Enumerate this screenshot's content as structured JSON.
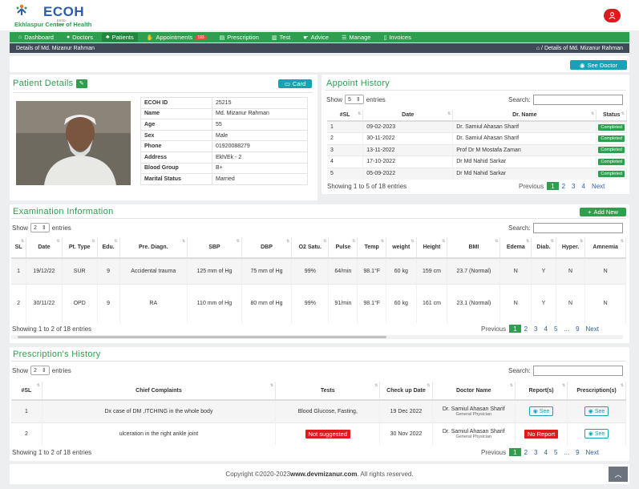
{
  "brand": {
    "name": "ECOH",
    "est": "ESTD. 1999",
    "subtitle": "Ekhlaspur Center of Health"
  },
  "nav": [
    {
      "label": "Dashboard",
      "icon": "dashboard-icon",
      "glyph": "⌂",
      "badge": ""
    },
    {
      "label": "Doctors",
      "icon": "user-md-icon",
      "glyph": "●",
      "badge": ""
    },
    {
      "label": "Patients",
      "icon": "users-icon",
      "glyph": "♣",
      "badge": ""
    },
    {
      "label": "Appointments",
      "icon": "handshake-icon",
      "glyph": "✋",
      "badge": "193"
    },
    {
      "label": "Prescription",
      "icon": "prescription-icon",
      "glyph": "▤",
      "badge": ""
    },
    {
      "label": "Test",
      "icon": "test-icon",
      "glyph": "▥",
      "badge": ""
    },
    {
      "label": "Advice",
      "icon": "advice-icon",
      "glyph": "☛",
      "badge": ""
    },
    {
      "label": "Manage",
      "icon": "list-icon",
      "glyph": "☰",
      "badge": ""
    },
    {
      "label": "Invoices",
      "icon": "invoice-icon",
      "glyph": "▯",
      "badge": ""
    }
  ],
  "breadcrumb": {
    "page": "Details of Md. Mizanur Rahman",
    "trail": "Details of Md. Mizanur Rahman",
    "sep": "/"
  },
  "see_doctor": "See Doctor",
  "patient": {
    "title": "Patient Details",
    "card_btn": "Card",
    "fields": [
      {
        "k": "ECOH ID",
        "v": "25215"
      },
      {
        "k": "Name",
        "v": "Md. Mizanur Rahman"
      },
      {
        "k": "Age",
        "v": "55"
      },
      {
        "k": "Sex",
        "v": "Male"
      },
      {
        "k": "Phone",
        "v": "01920088279"
      },
      {
        "k": "Address",
        "v": "Ekh/Ek - 2"
      },
      {
        "k": "Blood Group",
        "v": "B+"
      },
      {
        "k": "Marital Status",
        "v": "Married"
      }
    ]
  },
  "appoint": {
    "title": "Appoint History",
    "show": "Show",
    "entries": "entries",
    "show_val": "5",
    "search": "Search:",
    "headers": [
      "#SL",
      "Date",
      "Dr. Name",
      "Status"
    ],
    "rows": [
      [
        "1",
        "09-02-2023",
        "Dr. Samiul Ahasan Sharif",
        "Completed"
      ],
      [
        "2",
        "30-11-2022",
        "Dr. Samiul Ahasan Sharif",
        "Completed"
      ],
      [
        "3",
        "13-11-2022",
        "Prof Dr M Mostafa Zaman",
        "Completed"
      ],
      [
        "4",
        "17-10-2022",
        "Dr Md Nahid Sarkar",
        "Completed"
      ],
      [
        "5",
        "05-09-2022",
        "Dr Md Nahid Sarkar",
        "Completed"
      ]
    ],
    "info": "Showing 1 to 5 of 18 entries",
    "pager": {
      "prev": "Previous",
      "pages": [
        "1",
        "2",
        "3",
        "4"
      ],
      "next": "Next"
    }
  },
  "exam": {
    "title": "Examination Information",
    "add_btn": "Add New",
    "show": "Show",
    "entries": "entries",
    "show_val": "2",
    "search": "Search:",
    "headers": [
      "SL",
      "Date",
      "Pt. Type",
      "Edu.",
      "Pre. Diagn.",
      "SBP",
      "DBP",
      "O2 Satu.",
      "Pulse",
      "Temp",
      "weight",
      "Height",
      "BMI",
      "Edema",
      "Diab.",
      "Hyper.",
      "Amnemia"
    ],
    "rows": [
      [
        "1",
        "19/12/22",
        "SUR",
        "9",
        "Accidental trauma",
        "125 mm of Hg",
        "75 mm of Hg",
        "99%",
        "64/min",
        "98.1°F",
        "60 kg",
        "159 cm",
        "23.7 (Normal)",
        "N",
        "Y",
        "N",
        "N"
      ],
      [
        "2",
        "30/11/22",
        "OPD",
        "9",
        "RA",
        "110 mm of Hg",
        "80 mm of Hg",
        "99%",
        "91/min",
        "98.1°F",
        "60 kg",
        "161 cm",
        "23.1 (Normal)",
        "N",
        "Y",
        "N",
        "N"
      ]
    ],
    "info": "Showing 1 to 2 of 18 entries",
    "pager": {
      "prev": "Previous",
      "pages": [
        "1",
        "2",
        "3",
        "4",
        "5",
        "...",
        "9"
      ],
      "next": "Next"
    }
  },
  "presc": {
    "title": "Prescription's History",
    "show": "Show",
    "entries": "entries",
    "show_val": "2",
    "search": "Search:",
    "headers": [
      "#SL",
      "Chief Complaints",
      "Tests",
      "Check up Date",
      "Doctor Name",
      "Report(s)",
      "Prescription(s)"
    ],
    "rows": [
      {
        "sl": "1",
        "cc": "Dx case of DM ,ITCHING in the whole body",
        "tests": "Blood Glucose, Fasting,",
        "tests_flag": false,
        "date": "19 Dec 2022",
        "doc": "Dr. Samiul Ahasan Sharif",
        "role": "General Physician",
        "report": "See",
        "report_flag": false,
        "presc": "See"
      },
      {
        "sl": "2",
        "cc": "ulceration in the right ankle joint",
        "tests": "Not suggested",
        "tests_flag": true,
        "date": "30 Nov 2022",
        "doc": "Dr. Samiul Ahasan Sharif",
        "role": "General Physician",
        "report": "No Report",
        "report_flag": true,
        "presc": "See"
      }
    ],
    "info": "Showing 1 to 2 of 18 entries",
    "pager": {
      "prev": "Previous",
      "pages": [
        "1",
        "2",
        "3",
        "4",
        "5",
        "...",
        "9"
      ],
      "next": "Next"
    }
  },
  "footer": {
    "pre": "Copyright ©2020-2023 ",
    "link": "www.devmizanur.com",
    "post": ". All rights reserved."
  },
  "colors": {
    "green": "#2e9f4f",
    "teal": "#17a2b8",
    "red": "#e0191d",
    "dark": "#3f4a56"
  }
}
